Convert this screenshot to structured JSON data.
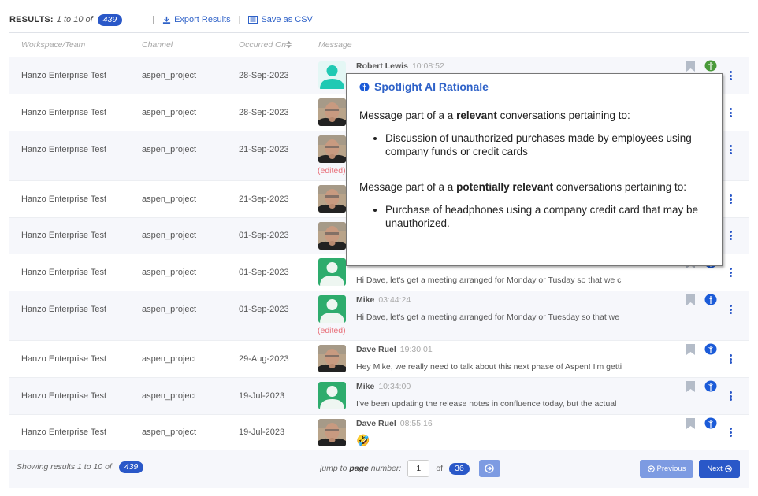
{
  "header": {
    "results_label": "RESULTS:",
    "results_range": "1 to 10 of",
    "results_total": "439",
    "export_label": "Export Results",
    "csv_label": "Save as CSV",
    "separator": "|"
  },
  "columns": {
    "workspace": "Workspace/Team",
    "channel": "Channel",
    "occurred_on": "Occurred On",
    "message": "Message"
  },
  "rows": [
    {
      "workspace": "Hanzo Enterprise Test",
      "channel": "aspen_project",
      "date": "28-Sep-2023",
      "author": "Robert Lewis",
      "time": "10:08:52",
      "text": "",
      "avatar": "generic-teal",
      "edited": false,
      "brain_color": "green"
    },
    {
      "workspace": "Hanzo Enterprise Test",
      "channel": "aspen_project",
      "date": "28-Sep-2023",
      "author": "",
      "time": "",
      "text": "",
      "avatar": "photo",
      "edited": false,
      "brain_color": "blue"
    },
    {
      "workspace": "Hanzo Enterprise Test",
      "channel": "aspen_project",
      "date": "21-Sep-2023",
      "author": "",
      "time": "",
      "text": "",
      "avatar": "photo",
      "edited": true,
      "brain_color": "blue"
    },
    {
      "workspace": "Hanzo Enterprise Test",
      "channel": "aspen_project",
      "date": "21-Sep-2023",
      "author": "",
      "time": "",
      "text": "",
      "avatar": "photo",
      "edited": false,
      "brain_color": "blue"
    },
    {
      "workspace": "Hanzo Enterprise Test",
      "channel": "aspen_project",
      "date": "01-Sep-2023",
      "author": "",
      "time": "",
      "text": "",
      "avatar": "photo",
      "edited": false,
      "brain_color": "blue"
    },
    {
      "workspace": "Hanzo Enterprise Test",
      "channel": "aspen_project",
      "date": "01-Sep-2023",
      "author": "",
      "time": "",
      "text": "Hi Dave, let's get a meeting arranged for Monday or Tusday so that we c",
      "avatar": "generic-green",
      "edited": false,
      "brain_color": "blue"
    },
    {
      "workspace": "Hanzo Enterprise Test",
      "channel": "aspen_project",
      "date": "01-Sep-2023",
      "author": "Mike",
      "time": "03:44:24",
      "text": "Hi Dave, let's get a meeting arranged for Monday or Tuesday so that we",
      "avatar": "generic-green",
      "edited": true,
      "brain_color": "blue"
    },
    {
      "workspace": "Hanzo Enterprise Test",
      "channel": "aspen_project",
      "date": "29-Aug-2023",
      "author": "Dave Ruel",
      "time": "19:30:01",
      "text": "Hey Mike, we really need to talk about this next phase of Aspen! I'm getti",
      "avatar": "photo",
      "edited": false,
      "brain_color": "blue"
    },
    {
      "workspace": "Hanzo Enterprise Test",
      "channel": "aspen_project",
      "date": "19-Jul-2023",
      "author": "Mike",
      "time": "10:34:00",
      "text": "I've been updating the release notes in confluence today, but the actual",
      "avatar": "generic-green",
      "edited": false,
      "brain_color": "blue"
    },
    {
      "workspace": "Hanzo Enterprise Test",
      "channel": "aspen_project",
      "date": "19-Jul-2023",
      "author": "Dave Ruel",
      "time": "08:55:16",
      "text": "🤣",
      "avatar": "photo",
      "edited": false,
      "brain_color": "blue"
    }
  ],
  "edited_label": "(edited)",
  "popup": {
    "title": "Spotlight AI Rationale",
    "p1_prefix": "Message part of a a ",
    "p1_bold": "relevant",
    "p1_suffix": " conversations pertaining to:",
    "p1_items": [
      "Discussion of unauthorized purchases made by employees using company funds or credit cards"
    ],
    "p2_prefix": "Message part of a a ",
    "p2_bold": "potentially relevant",
    "p2_suffix": " conversations pertaining to:",
    "p2_items": [
      "Purchase of headphones using a company credit card that may be unauthorized."
    ]
  },
  "footer": {
    "showing": "Showing results 1 to 10 of",
    "total": "439",
    "jump_prefix": "jump to ",
    "jump_bold": "page",
    "jump_suffix": " number:",
    "page_value": "1",
    "of_label": "of",
    "page_count": "36",
    "prev_label": "Previous",
    "next_label": "Next"
  },
  "colors": {
    "accent": "#2a58c8",
    "link": "#2f62c8",
    "brain_green": "#4a9a3a",
    "brain_blue": "#1b5bd8",
    "edited": "#e8707a",
    "avatar_teal": "#20c9b3",
    "avatar_green": "#2eac6d"
  }
}
